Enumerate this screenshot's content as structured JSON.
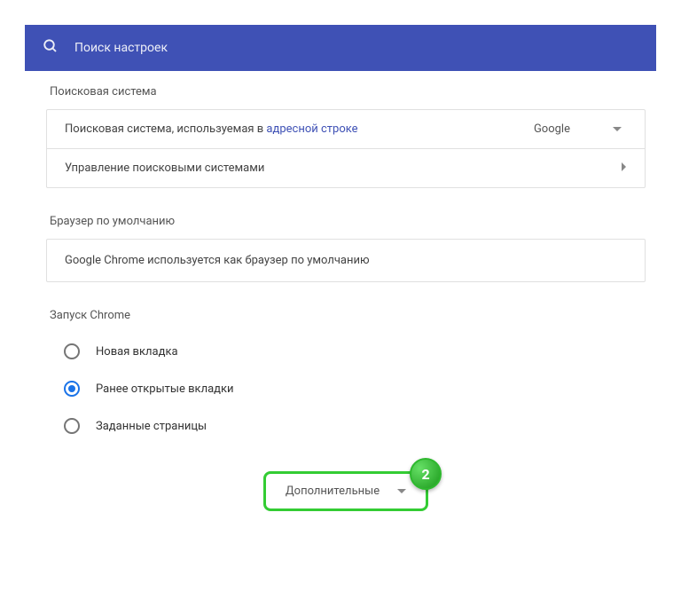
{
  "search": {
    "placeholder": "Поиск настроек"
  },
  "sections": {
    "searchEngine": {
      "title": "Поисковая система",
      "row1_prefix": "Поисковая система, используемая в ",
      "row1_link": "адресной строке",
      "selected": "Google",
      "row2": "Управление поисковыми системами"
    },
    "defaultBrowser": {
      "title": "Браузер по умолчанию",
      "text": "Google Chrome используется как браузер по умолчанию"
    },
    "startup": {
      "title": "Запуск Chrome",
      "options": [
        "Новая вкладка",
        "Ранее открытые вкладки",
        "Заданные страницы"
      ],
      "selectedIndex": 1
    }
  },
  "more": {
    "label": "Дополнительные",
    "badge": "2"
  }
}
